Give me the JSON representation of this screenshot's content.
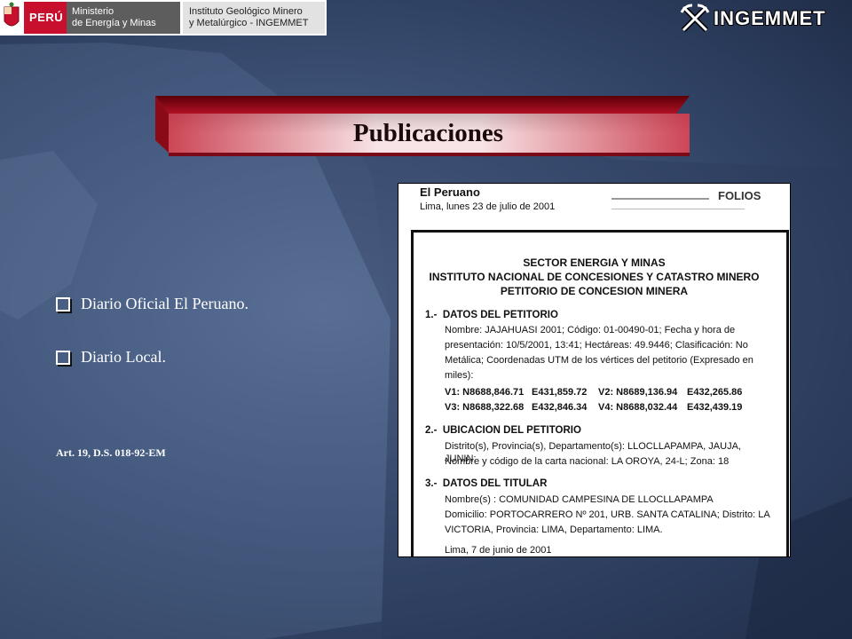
{
  "header": {
    "country": "PERÚ",
    "ministry": [
      "Ministerio",
      "de Energía y Minas"
    ],
    "institute": [
      "Instituto Geológico Minero",
      "y Metalúrgico - INGEMMET"
    ],
    "brand": "INGEMMET"
  },
  "title": "Publicaciones",
  "bullets": [
    "Diario Oficial El Peruano.",
    "Diario Local."
  ],
  "legal_reference": "Art. 19, D.S. 018-92-EM",
  "clipping": {
    "newspaper": "El Peruano",
    "date_line": "Lima, lunes 23 de julio de 2001",
    "stamp_text": "FOLIOS",
    "headings": [
      "SECTOR ENERGIA Y MINAS",
      "INSTITUTO NACIONAL DE CONCESIONES Y CATASTRO MINERO",
      "PETITORIO DE CONCESION MINERA"
    ],
    "sections": [
      {
        "num": "1.-",
        "title": "DATOS DEL PETITORIO",
        "lines": [
          "Nombre: JAJAHUASI 2001; Código: 01-00490-01; Fecha y hora de",
          "presentación: 10/5/2001, 13:41; Hectáreas: 49.9446; Clasificación: No",
          "Metálica; Coordenadas UTM de los vértices del petitorio (Expresado en",
          "miles):"
        ]
      },
      {
        "num": "2.-",
        "title": "UBICACION DEL PETITORIO",
        "lines": [
          "Distrito(s), Provincia(s), Departamento(s): LLOCLLAPAMPA, JAUJA, JUNIN;",
          "Nombre y código de la carta nacional: LA OROYA, 24-L; Zona: 18"
        ]
      },
      {
        "num": "3.-",
        "title": "DATOS DEL TITULAR",
        "lines": [
          "Nombre(s) :  COMUNIDAD CAMPESINA DE LLOCLLAPAMPA",
          "Domicilio: PORTOCARRERO Nº 201, URB. SANTA CATALINA; Distrito: LA",
          "VICTORIA, Provincia: LIMA, Departamento: LIMA."
        ]
      }
    ],
    "vertices": [
      [
        "V1: N8688,846.71",
        "E431,859.72",
        "V2: N8689,136.94",
        "E432,265.86"
      ],
      [
        "V3: N8688,322.68",
        "E432,846.34",
        "V4: N8688,032.44",
        "E432,439.19"
      ]
    ],
    "footer": "Lima, 7 de junio de 2001"
  }
}
